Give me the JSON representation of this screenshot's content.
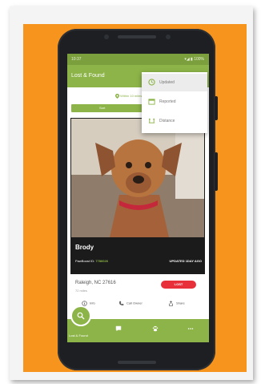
{
  "status_bar": {
    "time": "10:37",
    "right": "▾◢ ▮ 100%"
  },
  "app_bar": {
    "title": "Lost & Found"
  },
  "location_line": "Within 10 miles",
  "sort_bar_label": "Sort",
  "sort_menu": {
    "items": [
      {
        "label": "Updated",
        "icon": "clock-icon",
        "active": true
      },
      {
        "label": "Reported",
        "icon": "calendar-icon",
        "active": false
      },
      {
        "label": "Distance",
        "icon": "distance-icon",
        "active": false
      }
    ]
  },
  "pet_card": {
    "name": "Brody",
    "id_label": "PawBoost ID:",
    "id_value": "7786026",
    "updated": "UPDATED 1DAY AGO",
    "address": "Raleigh, NC 27616",
    "distance": "72 miles",
    "status": "LOST"
  },
  "actions": {
    "info": "Info",
    "call": "Call Owner",
    "share": "Share"
  },
  "bottom_nav": {
    "active_label": "Lost & Found"
  },
  "colors": {
    "brand_green": "#8cb448",
    "status_green": "#7a9f3c",
    "lost_red": "#e8303a",
    "background_orange": "#f7941d"
  }
}
